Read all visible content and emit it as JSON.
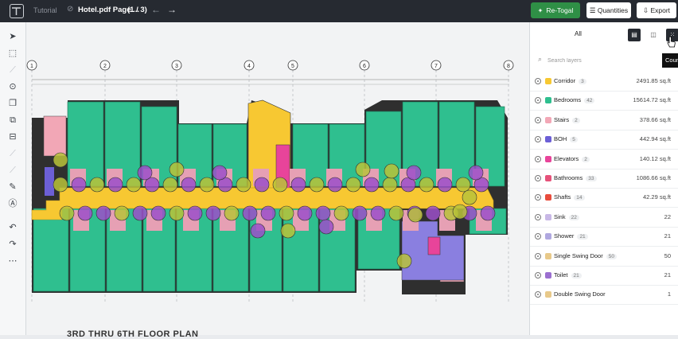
{
  "header": {
    "app": "Tutorial",
    "document": "Hotel.pdf Page ...",
    "page": "(1 / 3)",
    "retogal_label": "Re-Togal",
    "quantities_label": "Quantities",
    "export_label": "Export"
  },
  "plan": {
    "grid_labels": [
      "1",
      "2",
      "3",
      "4",
      "5",
      "6",
      "7",
      "8"
    ],
    "caption": "3RD THRU 6TH FLOOR PLAN"
  },
  "panel": {
    "tab_all": "All",
    "tooltip": "Counts",
    "search_placeholder": "Search layers",
    "layers": [
      {
        "name": "Corridor",
        "count": "3",
        "value": "2491.85 sq.ft",
        "color": "#f7c832"
      },
      {
        "name": "Bedrooms",
        "count": "42",
        "value": "15614.72 sq.ft",
        "color": "#2fbf8f"
      },
      {
        "name": "Stairs",
        "count": "2",
        "value": "378.66 sq.ft",
        "color": "#f2a7b6"
      },
      {
        "name": "BOH",
        "count": "5",
        "value": "442.94 sq.ft",
        "color": "#6c5fd6"
      },
      {
        "name": "Elevators",
        "count": "2",
        "value": "140.12 sq.ft",
        "color": "#e8449a"
      },
      {
        "name": "Bathrooms",
        "count": "33",
        "value": "1086.66 sq.ft",
        "color": "#e6527a"
      },
      {
        "name": "Shafts",
        "count": "14",
        "value": "42.29 sq.ft",
        "color": "#e84c3d"
      },
      {
        "name": "Sink",
        "count": "22",
        "value": "22",
        "color": "#c8b8e6"
      },
      {
        "name": "Shower",
        "count": "21",
        "value": "21",
        "color": "#b0a8e0"
      },
      {
        "name": "Single Swing Door",
        "count": "50",
        "value": "50",
        "color": "#e8c98a"
      },
      {
        "name": "Toilet",
        "count": "21",
        "value": "21",
        "color": "#9b6fd0"
      },
      {
        "name": "Double Swing Door",
        "count": "",
        "value": "1",
        "color": "#e8c98a"
      }
    ]
  },
  "colors": {
    "room_green": "#2fbf8f",
    "corridor_yellow": "#f7c832",
    "circle_olive": "#b9c23a",
    "circle_purple": "#9b4fc9",
    "accent_green": "#2f8f46"
  },
  "icons": {
    "toolbar": [
      "cursor-icon",
      "rectangle-select-icon",
      "polyline-icon",
      "target-icon",
      "copy-icon",
      "stack-icon",
      "layer-icon",
      "line-icon",
      "line-icon",
      "ruler-icon",
      "paint-icon",
      "undo-icon",
      "redo-icon",
      "more-icon"
    ]
  }
}
